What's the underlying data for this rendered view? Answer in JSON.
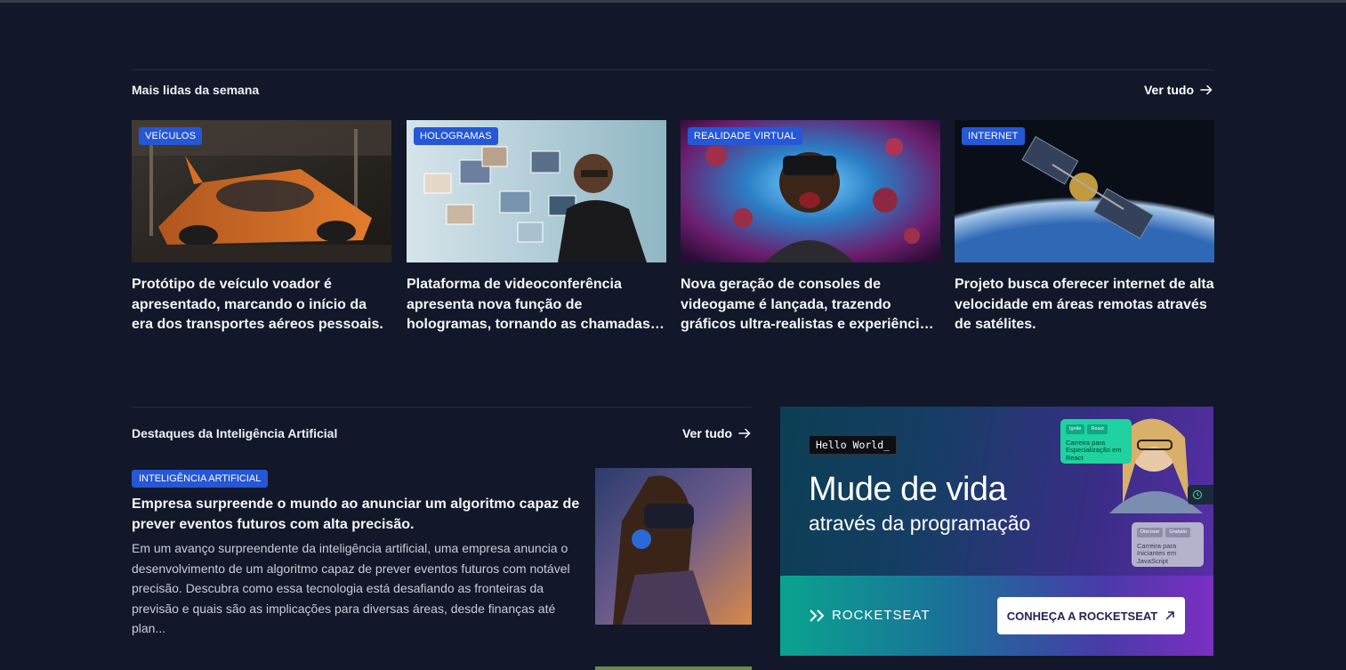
{
  "weekly": {
    "title": "Mais lidas da semana",
    "see_all": "Ver tudo",
    "cards": [
      {
        "tag": "VEÍCULOS",
        "title": "Protótipo de veículo voador é apresentado, marcando o início da era dos transportes aéreos pessoais."
      },
      {
        "tag": "HOLOGRAMAS",
        "title": "Plataforma de videoconferência apresenta nova função de hologramas, tornando as chamadas mais imersivas."
      },
      {
        "tag": "REALIDADE VIRTUAL",
        "title": "Nova geração de consoles de videogame é lançada, trazendo gráficos ultra-realistas e experiências imersivas."
      },
      {
        "tag": "INTERNET",
        "title": "Projeto busca oferecer internet de alta velocidade em áreas remotas através de satélites."
      }
    ]
  },
  "ai": {
    "title": "Destaques da Inteligência Artificial",
    "see_all": "Ver tudo",
    "feature": {
      "tag": "INTELIGÊNCIA ARTIFICIAL",
      "title": "Empresa surpreende o mundo ao anunciar um algoritmo capaz de prever eventos futuros com alta precisão.",
      "description": "Em um avanço surpreendente da inteligência artificial, uma empresa anuncia o desenvolvimento de um algoritmo capaz de prever eventos futuros com notável precisão. Descubra como essa tecnologia está desafiando as fronteiras da previsão e quais são as implicações para diversas áreas, desde finanças até plan..."
    }
  },
  "ad": {
    "hello": "Hello World_",
    "headline": "Mude de vida",
    "subheadline": "através da programação",
    "brand": "ROCKETSEAT",
    "cta": "CONHEÇA A ROCKETSEAT",
    "card1": {
      "chip1": "Ignite",
      "chip2": "React",
      "text": "Carreira para Especialização em React"
    },
    "card2": {
      "chip1": "Discover",
      "chip2": "Gratuito",
      "text": "Carreira para Iniciantes em JavaScript"
    }
  }
}
